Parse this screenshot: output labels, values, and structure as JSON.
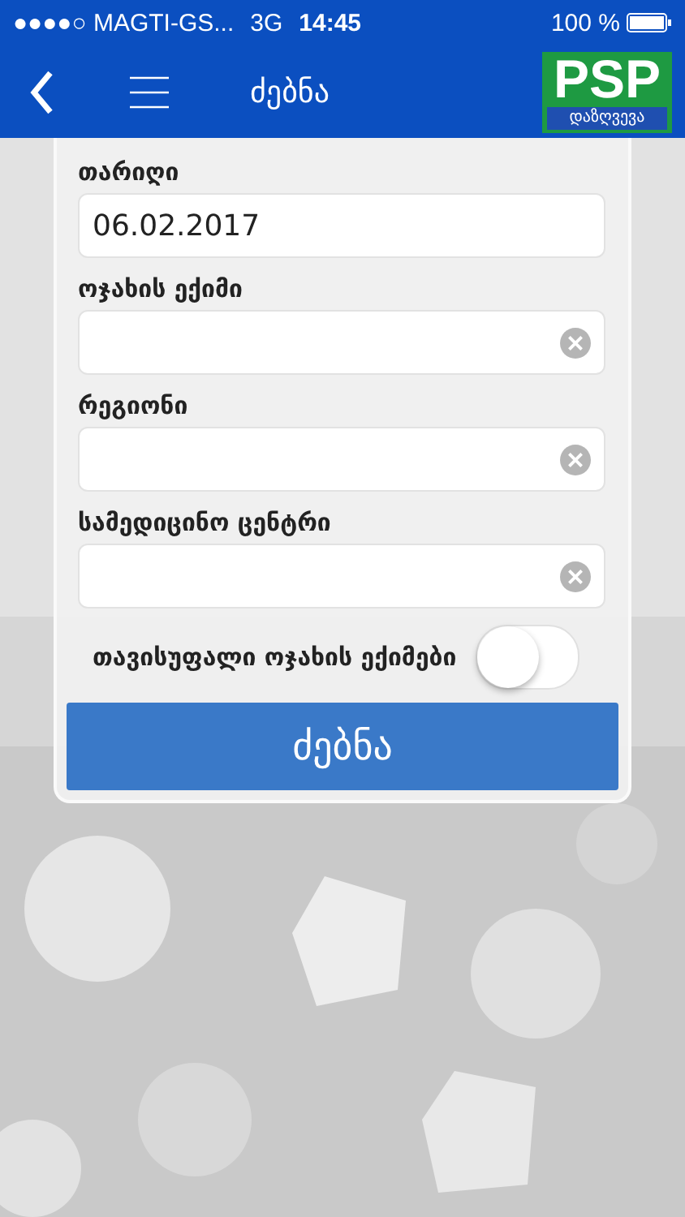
{
  "status_bar": {
    "carrier": "●●●●○ MAGTI-GS...",
    "network": "3G",
    "time": "14:45",
    "battery": "100 %"
  },
  "nav": {
    "title": "ძებნა",
    "logo": {
      "text": "PSP",
      "subtitle": "დაზღვევა"
    }
  },
  "form": {
    "fields": [
      {
        "label": "თარიღი",
        "value": "06.02.2017",
        "clearable": false
      },
      {
        "label": "ოჯახის ექიმი",
        "clearable": true
      },
      {
        "label": "რეგიონი",
        "clearable": true
      },
      {
        "label": "სამედიცინო ცენტრი",
        "clearable": true
      }
    ],
    "toggle": {
      "label": "თავისუფალი ოჯახის ექიმები",
      "on": false
    },
    "submit": "ძებნა"
  }
}
